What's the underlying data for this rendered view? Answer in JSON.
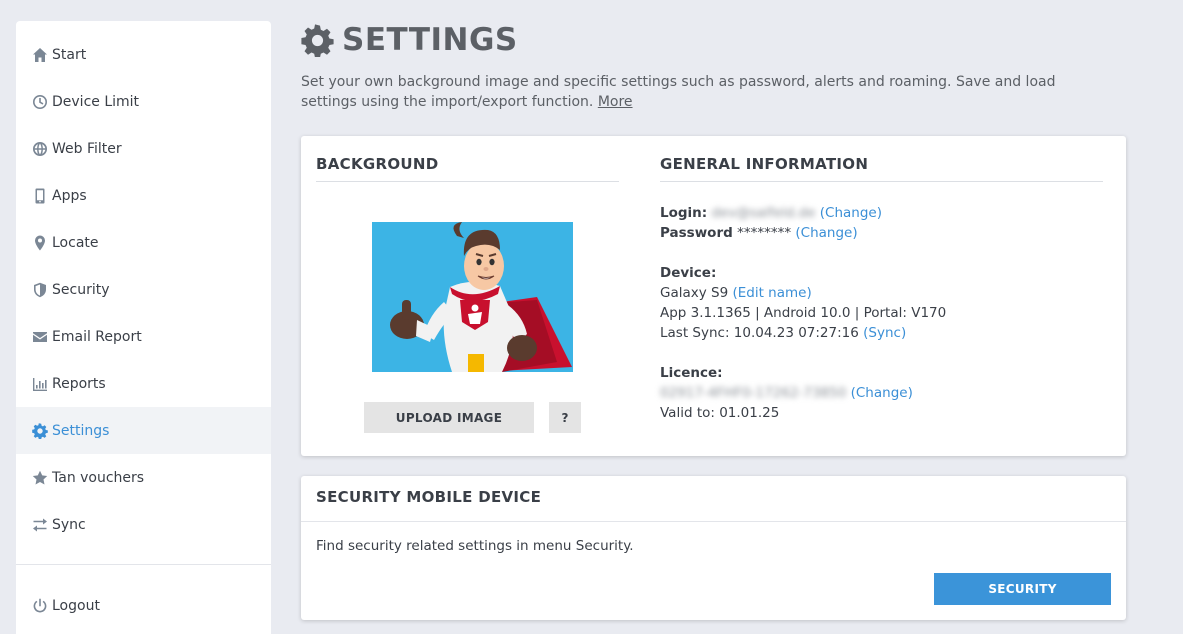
{
  "sidebar": {
    "items": [
      {
        "label": "Start",
        "icon": "home-icon"
      },
      {
        "label": "Device Limit",
        "icon": "clock-icon"
      },
      {
        "label": "Web Filter",
        "icon": "globe-icon"
      },
      {
        "label": "Apps",
        "icon": "phone-icon"
      },
      {
        "label": "Locate",
        "icon": "map-pin-icon"
      },
      {
        "label": "Security",
        "icon": "shield-icon"
      },
      {
        "label": "Email Report",
        "icon": "envelope-icon"
      },
      {
        "label": "Reports",
        "icon": "bar-chart-icon"
      },
      {
        "label": "Settings",
        "icon": "gear-icon",
        "active": true
      },
      {
        "label": "Tan vouchers",
        "icon": "star-icon"
      },
      {
        "label": "Sync",
        "icon": "sync-arrows-icon"
      }
    ],
    "logout": "Logout"
  },
  "header": {
    "title": "SETTINGS",
    "description": "Set your own background image and specific settings such as password, alerts and roaming. Save and load settings using the import/export function.",
    "more_link": "More"
  },
  "background": {
    "title": "BACKGROUND",
    "upload_label": "UPLOAD IMAGE",
    "help_label": "?"
  },
  "general": {
    "title": "GENERAL INFORMATION",
    "login_label": "Login:",
    "login_value": "dev@salfeld.de",
    "change_label": "(Change)",
    "password_label": "Password",
    "password_value": "********",
    "device_label": "Device:",
    "device_name": "Galaxy S9",
    "edit_name_label": "(Edit name)",
    "app_info": "App 3.1.1365 | Android 10.0 | Portal: V170",
    "last_sync": "Last Sync: 10.04.23 07:27:16",
    "sync_label": "(Sync)",
    "licence_label": "Licence:",
    "licence_value": "02917-4FHF0-17262-73850",
    "valid_to": "Valid to: 01.01.25"
  },
  "security_card": {
    "title": "SECURITY MOBILE DEVICE",
    "description": "Find security related settings in menu Security.",
    "button_label": "SECURITY"
  },
  "colors": {
    "accent": "#3b8fd6",
    "button_primary": "#3b94d9",
    "page_bg": "#e9ebf1"
  }
}
